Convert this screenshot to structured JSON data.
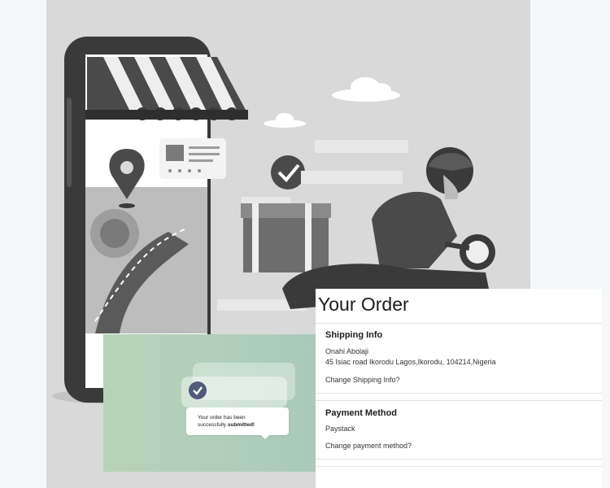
{
  "order": {
    "title": "Your Order",
    "shipping_heading": "Shipping Info",
    "shipping_name": "Onahi Abolaji",
    "shipping_address": "45 Isiac road Ikorodu Lagos,Ikorodu, 104214,Nigeria",
    "shipping_change": "Change Shipping Info?",
    "payment_heading": "Payment Method",
    "payment_method": "Paystack",
    "payment_change": "Change payment method?"
  },
  "toast": {
    "message_prefix": "Your order has been successfully",
    "message_bold": "submitted!"
  },
  "colors": {
    "hero_bg": "#d9d9d9",
    "toast_gradient_start": "#b7d4b9",
    "toast_gradient_end": "#a6c6bb",
    "check_circle": "#4e5b7a"
  },
  "icons": [
    "map-pin-icon",
    "check-circle-icon",
    "store-awning-icon",
    "delivery-rider-icon"
  ]
}
